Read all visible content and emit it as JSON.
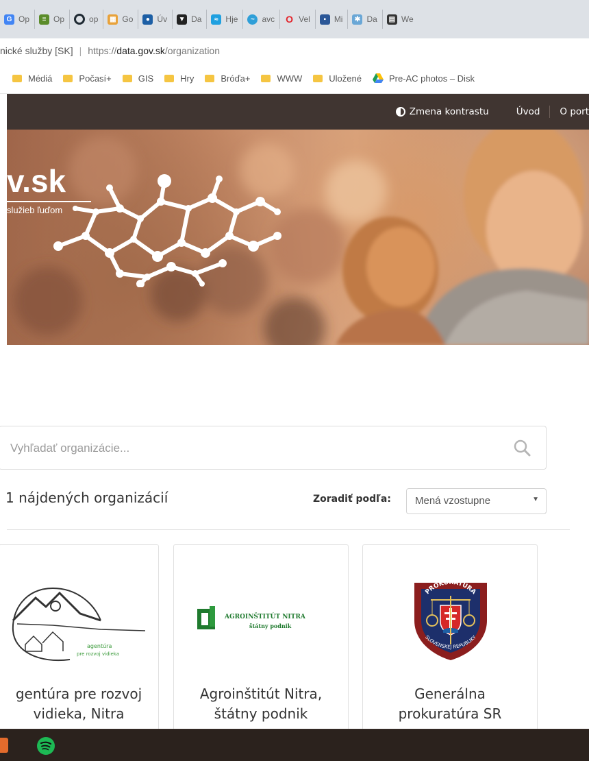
{
  "browser": {
    "tabs": [
      {
        "label": "Op",
        "icon": "chrome-app-icon",
        "color": "#4285f4"
      },
      {
        "label": "Op",
        "icon": "books-icon",
        "color": "#5b8c2a"
      },
      {
        "label": "op",
        "icon": "opera-ring-icon",
        "color": "#1f2a33"
      },
      {
        "label": "Go",
        "icon": "sheets-grid-icon",
        "color": "#e8a23a"
      },
      {
        "label": "Úv",
        "icon": "circle-badge-icon",
        "color": "#1d5fa5"
      },
      {
        "label": "Da",
        "icon": "shield-icon",
        "color": "#222222"
      },
      {
        "label": "Hje",
        "icon": "hje-icon",
        "color": "#1fa0e0"
      },
      {
        "label": "avc",
        "icon": "fish-icon",
        "color": "#2f9fd8"
      },
      {
        "label": "Vel",
        "icon": "opera-o-icon",
        "color": "#e3242b"
      },
      {
        "label": "Mi",
        "icon": "doc-icon",
        "color": "#2b5797"
      },
      {
        "label": "Da",
        "icon": "hands-icon",
        "color": "#6aa7d6"
      },
      {
        "label": "We",
        "icon": "calendar-icon",
        "color": "#333333"
      }
    ],
    "url": {
      "site_name": "nické služby [SK]",
      "scheme": "https://",
      "host": "data.gov.sk",
      "path": "/organization"
    },
    "bookmarks": [
      "Médiá",
      "Počasí+",
      "GIS",
      "Hry",
      "Bróďa+",
      "WWW",
      "Uložené",
      "Pre-AC photos – Disk"
    ]
  },
  "site": {
    "nav": {
      "contrast": "Zmena kontrastu",
      "home": "Úvod",
      "about": "O port"
    },
    "hero": {
      "logo_text": "v.sk",
      "tagline": "služieb ľuďom"
    },
    "search": {
      "placeholder": "Vyhľadať organizácie..."
    },
    "results": {
      "count_text": "1 nájdených organizácií",
      "sort_label": "Zoradiť podľa:",
      "sort_value": "Mená vzostupne"
    },
    "organizations": [
      {
        "title": "gentúra pre rozvoj vidieka, Nitra",
        "logo_text_1": "agentúra",
        "logo_text_2": "pre rozvoj vidieka"
      },
      {
        "title": "Agroinštitút Nitra, štátny podnik",
        "logo_text_1": "AGROINŠTITÚT NITRA",
        "logo_text_2": "štátny podnik"
      },
      {
        "title": "Generálna prokuratúra SR",
        "logo_text_1": "PROKURATÚRA",
        "logo_text_2": "SLOVENSKEJ REPUBLIKY"
      }
    ]
  },
  "colors": {
    "nav_bg": "#403531",
    "taskbar_bg": "#2b221d",
    "spotify": "#1db954",
    "accent_green": "#3a9a3a"
  }
}
